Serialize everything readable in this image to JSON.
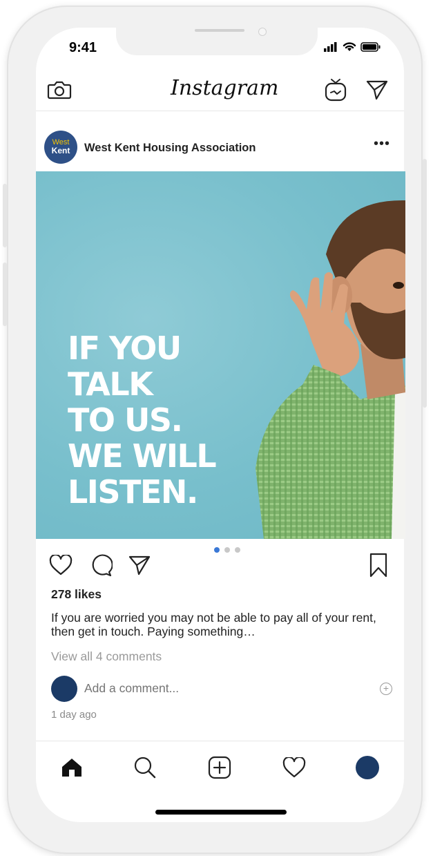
{
  "status_bar": {
    "time": "9:41"
  },
  "app": {
    "logo_text": "Instagram"
  },
  "post": {
    "avatar_line1": "West",
    "avatar_line2": "Kent",
    "username": "West Kent Housing Association",
    "more": "•••",
    "headline": [
      "IF YOU",
      "TALK",
      "TO US.",
      "WE WILL",
      "LISTEN."
    ],
    "carousel_total": 3,
    "carousel_active": 1,
    "likes": "278 likes",
    "caption": "If you are worried you may not be able to pay all of your rent, then get in touch. Paying something…",
    "view_all": "View all 4 comments",
    "comment_placeholder": "Add a comment...",
    "timestamp": "1 day ago"
  },
  "colors": {
    "image_bg": "#78bfcc",
    "brand_avatar": "#2e5087",
    "user_avatar": "#1b3a66",
    "active_dot": "#3a78d6"
  },
  "icons": {
    "header": [
      "camera-icon",
      "igtv-icon",
      "direct-message-icon"
    ],
    "actions": [
      "heart-icon",
      "comment-icon",
      "share-icon",
      "bookmark-icon"
    ],
    "nav": [
      "home-icon",
      "search-icon",
      "add-post-icon",
      "activity-heart-icon",
      "profile-avatar"
    ]
  }
}
